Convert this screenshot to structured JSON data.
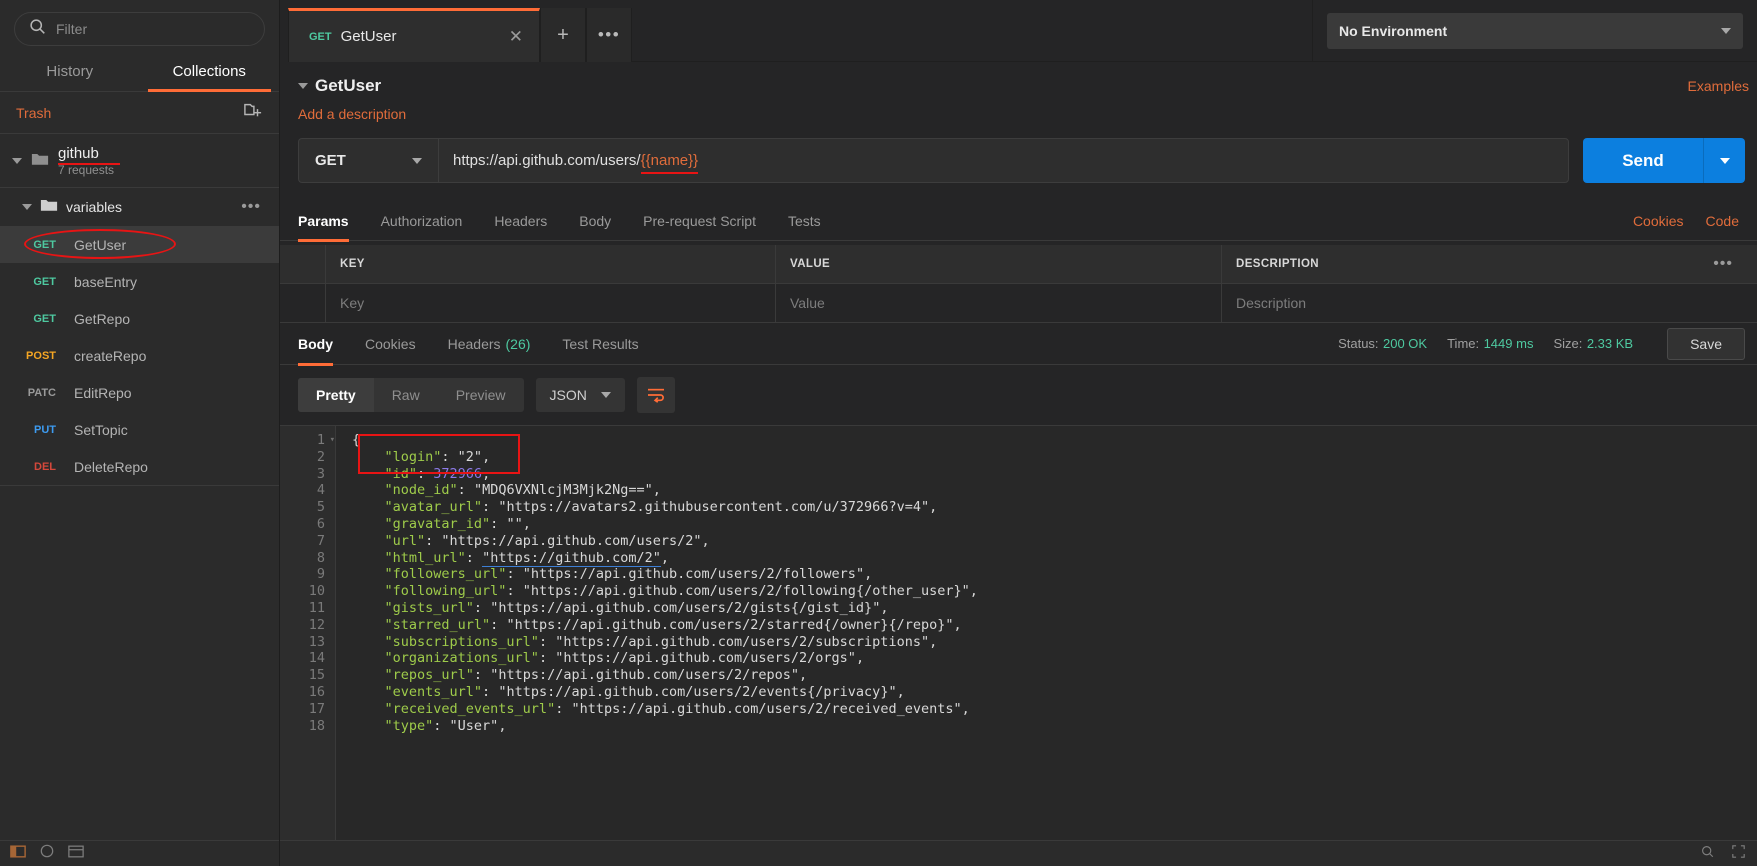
{
  "sidebar": {
    "filter": {
      "placeholder": "Filter",
      "value": ""
    },
    "tabs": [
      {
        "label": "History",
        "active": false
      },
      {
        "label": "Collections",
        "active": true
      }
    ],
    "trash_label": "Trash",
    "new_folder_icon": "new-collection-icon",
    "collection": {
      "name": "github",
      "subtitle": "7 requests"
    },
    "folder": {
      "name": "variables",
      "menu": "•••"
    },
    "requests": [
      {
        "method": "GET",
        "name": "GetUser",
        "selected": true,
        "annotated": true
      },
      {
        "method": "GET",
        "name": "baseEntry",
        "selected": false,
        "annotated": false
      },
      {
        "method": "GET",
        "name": "GetRepo",
        "selected": false,
        "annotated": false
      },
      {
        "method": "POST",
        "name": "createRepo",
        "selected": false,
        "annotated": false
      },
      {
        "method": "PATC",
        "name": "EditRepo",
        "selected": false,
        "annotated": false
      },
      {
        "method": "PUT",
        "name": "SetTopic",
        "selected": false,
        "annotated": false
      },
      {
        "method": "DEL",
        "name": "DeleteRepo",
        "selected": false,
        "annotated": false
      }
    ]
  },
  "topbar": {
    "tab": {
      "method": "GET",
      "name": "GetUser",
      "close": "✕"
    },
    "new_tab": "+",
    "tab_menu": "•••",
    "environment": {
      "value": "No Environment"
    }
  },
  "request": {
    "title": "GetUser",
    "description_link": "Add a description",
    "examples_link": "Examples",
    "method": "GET",
    "url_base": "https://api.github.com/users/",
    "url_variable": "{{name}}",
    "send_label": "Send",
    "tabs": [
      {
        "label": "Params",
        "active": true
      },
      {
        "label": "Authorization",
        "active": false
      },
      {
        "label": "Headers",
        "active": false
      },
      {
        "label": "Body",
        "active": false
      },
      {
        "label": "Pre-request Script",
        "active": false
      },
      {
        "label": "Tests",
        "active": false
      }
    ],
    "right_links": [
      "Cookies",
      "Code"
    ],
    "params_table": {
      "headers": [
        "KEY",
        "VALUE",
        "DESCRIPTION"
      ],
      "placeholder_row": [
        "Key",
        "Value",
        "Description"
      ],
      "bulk_edit_icon": "•••"
    }
  },
  "response": {
    "tabs": [
      {
        "label": "Body",
        "count": "",
        "active": true
      },
      {
        "label": "Cookies",
        "count": "",
        "active": false
      },
      {
        "label": "Headers",
        "count": "(26)",
        "active": false
      },
      {
        "label": "Test Results",
        "count": "",
        "active": false
      }
    ],
    "status_key": "Status:",
    "status_value": "200 OK",
    "time_key": "Time:",
    "time_value": "1449 ms",
    "size_key": "Size:",
    "size_value": "2.33 KB",
    "save_label": "Save",
    "view_modes": [
      {
        "label": "Pretty",
        "active": true
      },
      {
        "label": "Raw",
        "active": false
      },
      {
        "label": "Preview",
        "active": false
      }
    ],
    "format": "JSON",
    "wrap_icon": "wrap-lines-icon",
    "body_lines": [
      {
        "n": 1,
        "fold": "▾",
        "parts": [
          {
            "t": "{",
            "c": "p"
          }
        ]
      },
      {
        "n": 2,
        "fold": "",
        "parts": [
          {
            "t": "    \"login\"",
            "c": "k"
          },
          {
            "t": ": ",
            "c": "p"
          },
          {
            "t": "\"2\"",
            "c": "s"
          },
          {
            "t": ",",
            "c": "p"
          }
        ]
      },
      {
        "n": 3,
        "fold": "",
        "parts": [
          {
            "t": "    \"id\"",
            "c": "k"
          },
          {
            "t": ": ",
            "c": "p"
          },
          {
            "t": "372966",
            "c": "n"
          },
          {
            "t": ",",
            "c": "p"
          }
        ]
      },
      {
        "n": 4,
        "fold": "",
        "parts": [
          {
            "t": "    \"node_id\"",
            "c": "k"
          },
          {
            "t": ": ",
            "c": "p"
          },
          {
            "t": "\"MDQ6VXNlcjM3Mjk2Ng==\"",
            "c": "s"
          },
          {
            "t": ",",
            "c": "p"
          }
        ]
      },
      {
        "n": 5,
        "fold": "",
        "parts": [
          {
            "t": "    \"avatar_url\"",
            "c": "k"
          },
          {
            "t": ": ",
            "c": "p"
          },
          {
            "t": "\"https://avatars2.githubusercontent.com/u/372966?v=4\"",
            "c": "s"
          },
          {
            "t": ",",
            "c": "p"
          }
        ]
      },
      {
        "n": 6,
        "fold": "",
        "parts": [
          {
            "t": "    \"gravatar_id\"",
            "c": "k"
          },
          {
            "t": ": ",
            "c": "p"
          },
          {
            "t": "\"\"",
            "c": "s"
          },
          {
            "t": ",",
            "c": "p"
          }
        ]
      },
      {
        "n": 7,
        "fold": "",
        "parts": [
          {
            "t": "    \"url\"",
            "c": "k"
          },
          {
            "t": ": ",
            "c": "p"
          },
          {
            "t": "\"https://api.github.com/users/2\"",
            "c": "s"
          },
          {
            "t": ",",
            "c": "p"
          }
        ]
      },
      {
        "n": 8,
        "fold": "",
        "parts": [
          {
            "t": "    \"html_url\"",
            "c": "k"
          },
          {
            "t": ": ",
            "c": "p"
          },
          {
            "t": "\"https://github.com/2\"",
            "c": "lnk"
          },
          {
            "t": ",",
            "c": "p"
          }
        ]
      },
      {
        "n": 9,
        "fold": "",
        "parts": [
          {
            "t": "    \"followers_url\"",
            "c": "k"
          },
          {
            "t": ": ",
            "c": "p"
          },
          {
            "t": "\"https://api.github.com/users/2/followers\"",
            "c": "s"
          },
          {
            "t": ",",
            "c": "p"
          }
        ]
      },
      {
        "n": 10,
        "fold": "",
        "parts": [
          {
            "t": "    \"following_url\"",
            "c": "k"
          },
          {
            "t": ": ",
            "c": "p"
          },
          {
            "t": "\"https://api.github.com/users/2/following{/other_user}\"",
            "c": "s"
          },
          {
            "t": ",",
            "c": "p"
          }
        ]
      },
      {
        "n": 11,
        "fold": "",
        "parts": [
          {
            "t": "    \"gists_url\"",
            "c": "k"
          },
          {
            "t": ": ",
            "c": "p"
          },
          {
            "t": "\"https://api.github.com/users/2/gists{/gist_id}\"",
            "c": "s"
          },
          {
            "t": ",",
            "c": "p"
          }
        ]
      },
      {
        "n": 12,
        "fold": "",
        "parts": [
          {
            "t": "    \"starred_url\"",
            "c": "k"
          },
          {
            "t": ": ",
            "c": "p"
          },
          {
            "t": "\"https://api.github.com/users/2/starred{/owner}{/repo}\"",
            "c": "s"
          },
          {
            "t": ",",
            "c": "p"
          }
        ]
      },
      {
        "n": 13,
        "fold": "",
        "parts": [
          {
            "t": "    \"subscriptions_url\"",
            "c": "k"
          },
          {
            "t": ": ",
            "c": "p"
          },
          {
            "t": "\"https://api.github.com/users/2/subscriptions\"",
            "c": "s"
          },
          {
            "t": ",",
            "c": "p"
          }
        ]
      },
      {
        "n": 14,
        "fold": "",
        "parts": [
          {
            "t": "    \"organizations_url\"",
            "c": "k"
          },
          {
            "t": ": ",
            "c": "p"
          },
          {
            "t": "\"https://api.github.com/users/2/orgs\"",
            "c": "s"
          },
          {
            "t": ",",
            "c": "p"
          }
        ]
      },
      {
        "n": 15,
        "fold": "",
        "parts": [
          {
            "t": "    \"repos_url\"",
            "c": "k"
          },
          {
            "t": ": ",
            "c": "p"
          },
          {
            "t": "\"https://api.github.com/users/2/repos\"",
            "c": "s"
          },
          {
            "t": ",",
            "c": "p"
          }
        ]
      },
      {
        "n": 16,
        "fold": "",
        "parts": [
          {
            "t": "    \"events_url\"",
            "c": "k"
          },
          {
            "t": ": ",
            "c": "p"
          },
          {
            "t": "\"https://api.github.com/users/2/events{/privacy}\"",
            "c": "s"
          },
          {
            "t": ",",
            "c": "p"
          }
        ]
      },
      {
        "n": 17,
        "fold": "",
        "parts": [
          {
            "t": "    \"received_events_url\"",
            "c": "k"
          },
          {
            "t": ": ",
            "c": "p"
          },
          {
            "t": "\"https://api.github.com/users/2/received_events\"",
            "c": "s"
          },
          {
            "t": ",",
            "c": "p"
          }
        ]
      },
      {
        "n": 18,
        "fold": "",
        "parts": [
          {
            "t": "    \"type\"",
            "c": "k"
          },
          {
            "t": ": ",
            "c": "p"
          },
          {
            "t": "\"User\"",
            "c": "s"
          },
          {
            "t": ",",
            "c": "p"
          }
        ]
      }
    ]
  },
  "colors": {
    "accent": "#ff6c37",
    "send": "#0c7fdf",
    "ok": "#4ec9a0",
    "annotation": "#e81414"
  }
}
